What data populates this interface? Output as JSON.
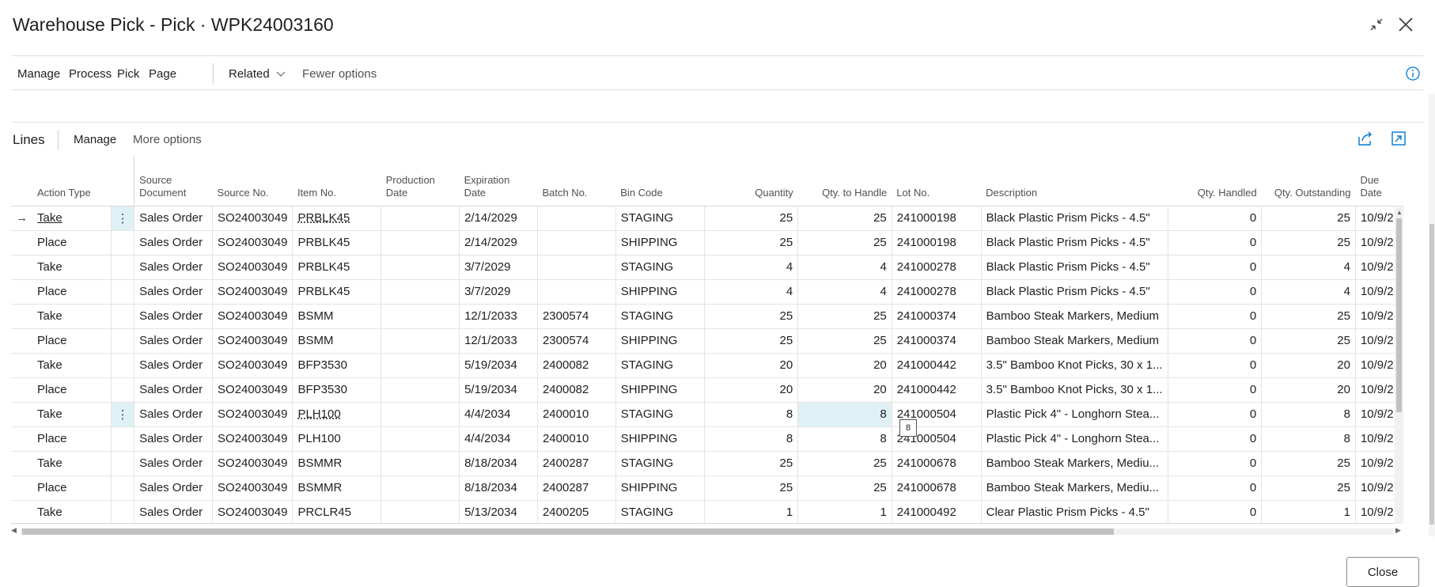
{
  "window": {
    "title": "Warehouse Pick - Pick · WPK24003160",
    "collapse_icon": "collapse-icon",
    "close_icon": "close-icon"
  },
  "actions": {
    "manage": "Manage",
    "process": "Process",
    "pick": "Pick",
    "page": "Page",
    "related": "Related",
    "fewer_options": "Fewer options",
    "info_icon": "info-icon"
  },
  "lines": {
    "title": "Lines",
    "manage": "Manage",
    "more_options": "More options",
    "share_icon": "share-icon",
    "expand_icon": "expand-icon"
  },
  "columns": {
    "action_type": "Action Type",
    "source_document": "Source Document",
    "source_no": "Source No.",
    "item_no": "Item No.",
    "production_date": "Production Date",
    "expiration_date": "Expiration Date",
    "batch_no": "Batch No.",
    "bin_code": "Bin Code",
    "quantity": "Quantity",
    "qty_to_handle": "Qty. to Handle",
    "lot_no": "Lot No.",
    "description": "Description",
    "qty_handled": "Qty. Handled",
    "qty_outstanding": "Qty. Outstanding",
    "due_date": "Due Date"
  },
  "rows": [
    {
      "action": "Take",
      "src_doc": "Sales Order",
      "src_no": "SO24003049",
      "item": "PRBLK45",
      "prod": "",
      "exp": "2/14/2029",
      "batch": "",
      "bin": "STAGING",
      "qty": "25",
      "to_handle": "25",
      "lot": "241000198",
      "desc": "Black Plastic Prism Picks - 4.5\"",
      "handled": "0",
      "outstanding": "25",
      "due": "10/9/2"
    },
    {
      "action": "Place",
      "src_doc": "Sales Order",
      "src_no": "SO24003049",
      "item": "PRBLK45",
      "prod": "",
      "exp": "2/14/2029",
      "batch": "",
      "bin": "SHIPPING",
      "qty": "25",
      "to_handle": "25",
      "lot": "241000198",
      "desc": "Black Plastic Prism Picks - 4.5\"",
      "handled": "0",
      "outstanding": "25",
      "due": "10/9/2"
    },
    {
      "action": "Take",
      "src_doc": "Sales Order",
      "src_no": "SO24003049",
      "item": "PRBLK45",
      "prod": "",
      "exp": "3/7/2029",
      "batch": "",
      "bin": "STAGING",
      "qty": "4",
      "to_handle": "4",
      "lot": "241000278",
      "desc": "Black Plastic Prism Picks - 4.5\"",
      "handled": "0",
      "outstanding": "4",
      "due": "10/9/2"
    },
    {
      "action": "Place",
      "src_doc": "Sales Order",
      "src_no": "SO24003049",
      "item": "PRBLK45",
      "prod": "",
      "exp": "3/7/2029",
      "batch": "",
      "bin": "SHIPPING",
      "qty": "4",
      "to_handle": "4",
      "lot": "241000278",
      "desc": "Black Plastic Prism Picks - 4.5\"",
      "handled": "0",
      "outstanding": "4",
      "due": "10/9/2"
    },
    {
      "action": "Take",
      "src_doc": "Sales Order",
      "src_no": "SO24003049",
      "item": "BSMM",
      "prod": "",
      "exp": "12/1/2033",
      "batch": "2300574",
      "bin": "STAGING",
      "qty": "25",
      "to_handle": "25",
      "lot": "241000374",
      "desc": "Bamboo Steak Markers, Medium",
      "handled": "0",
      "outstanding": "25",
      "due": "10/9/2"
    },
    {
      "action": "Place",
      "src_doc": "Sales Order",
      "src_no": "SO24003049",
      "item": "BSMM",
      "prod": "",
      "exp": "12/1/2033",
      "batch": "2300574",
      "bin": "SHIPPING",
      "qty": "25",
      "to_handle": "25",
      "lot": "241000374",
      "desc": "Bamboo Steak Markers, Medium",
      "handled": "0",
      "outstanding": "25",
      "due": "10/9/2"
    },
    {
      "action": "Take",
      "src_doc": "Sales Order",
      "src_no": "SO24003049",
      "item": "BFP3530",
      "prod": "",
      "exp": "5/19/2034",
      "batch": "2400082",
      "bin": "STAGING",
      "qty": "20",
      "to_handle": "20",
      "lot": "241000442",
      "desc": "3.5\" Bamboo Knot Picks, 30 x 1...",
      "handled": "0",
      "outstanding": "20",
      "due": "10/9/2"
    },
    {
      "action": "Place",
      "src_doc": "Sales Order",
      "src_no": "SO24003049",
      "item": "BFP3530",
      "prod": "",
      "exp": "5/19/2034",
      "batch": "2400082",
      "bin": "SHIPPING",
      "qty": "20",
      "to_handle": "20",
      "lot": "241000442",
      "desc": "3.5\" Bamboo Knot Picks, 30 x 1...",
      "handled": "0",
      "outstanding": "20",
      "due": "10/9/2"
    },
    {
      "action": "Take",
      "src_doc": "Sales Order",
      "src_no": "SO24003049",
      "item": "PLH100",
      "prod": "",
      "exp": "4/4/2034",
      "batch": "2400010",
      "bin": "STAGING",
      "qty": "8",
      "to_handle": "8",
      "lot": "241000504",
      "desc": "Plastic Pick 4\" - Longhorn Stea...",
      "handled": "0",
      "outstanding": "8",
      "due": "10/9/2"
    },
    {
      "action": "Place",
      "src_doc": "Sales Order",
      "src_no": "SO24003049",
      "item": "PLH100",
      "prod": "",
      "exp": "4/4/2034",
      "batch": "2400010",
      "bin": "SHIPPING",
      "qty": "8",
      "to_handle": "8",
      "lot": "241000504",
      "desc": "Plastic Pick 4\" - Longhorn Stea...",
      "handled": "0",
      "outstanding": "8",
      "due": "10/9/2"
    },
    {
      "action": "Take",
      "src_doc": "Sales Order",
      "src_no": "SO24003049",
      "item": "BSMMR",
      "prod": "",
      "exp": "8/18/2034",
      "batch": "2400287",
      "bin": "STAGING",
      "qty": "25",
      "to_handle": "25",
      "lot": "241000678",
      "desc": "Bamboo Steak Markers, Mediu...",
      "handled": "0",
      "outstanding": "25",
      "due": "10/9/2"
    },
    {
      "action": "Place",
      "src_doc": "Sales Order",
      "src_no": "SO24003049",
      "item": "BSMMR",
      "prod": "",
      "exp": "8/18/2034",
      "batch": "2400287",
      "bin": "SHIPPING",
      "qty": "25",
      "to_handle": "25",
      "lot": "241000678",
      "desc": "Bamboo Steak Markers, Mediu...",
      "handled": "0",
      "outstanding": "25",
      "due": "10/9/2"
    },
    {
      "action": "Take",
      "src_doc": "Sales Order",
      "src_no": "SO24003049",
      "item": "PRCLR45",
      "prod": "",
      "exp": "5/13/2034",
      "batch": "2400205",
      "bin": "STAGING",
      "qty": "1",
      "to_handle": "1",
      "lot": "241000492",
      "desc": "Clear Plastic Prism Picks - 4.5\"",
      "handled": "0",
      "outstanding": "1",
      "due": "10/9/2"
    }
  ],
  "tooltip": "8",
  "footer": {
    "close": "Close"
  },
  "colors": {
    "accent": "#0078d4",
    "selected_cell": "#dff1f5"
  }
}
